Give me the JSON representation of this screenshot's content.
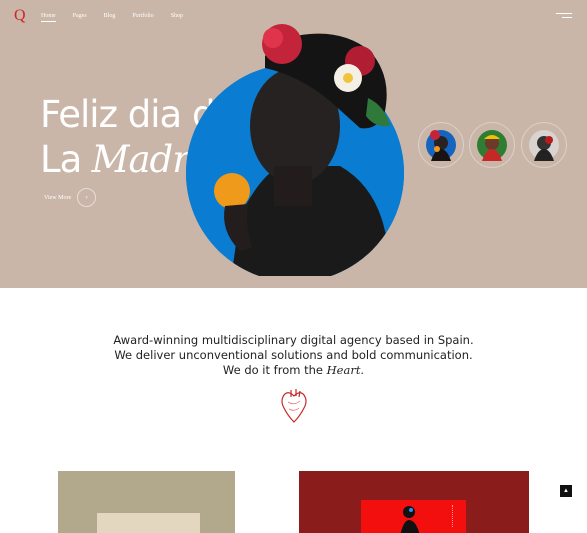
{
  "logo": {
    "text": "Q",
    "color": "#d2232a"
  },
  "nav": {
    "items": [
      "Home",
      "Pages",
      "Blog",
      "Portfolio",
      "Shop"
    ],
    "active": "Home"
  },
  "menu": {
    "icon": "hamburger-icon"
  },
  "hero": {
    "title_line1": "Feliz dia de",
    "title_line2_plain": "La",
    "title_line2_italic": "Madre",
    "view_more": "View More",
    "background_color": "#c9b6a8",
    "circle_color": "#0a7cd1"
  },
  "thumbnails": [
    "portrait-thumbnail-1",
    "portrait-thumbnail-2",
    "portrait-thumbnail-3"
  ],
  "intro": {
    "line1": "Award-winning multidisciplinary digital agency based in Spain.",
    "line2": "We deliver unconventional solutions and bold communication.",
    "line3_plain": "We do it from the",
    "line3_italic": "Heart."
  },
  "colors": {
    "accent_red": "#d2232a",
    "card_red": "#8a1d1c",
    "card_tan": "#b2a98c"
  },
  "scroll_top": {
    "icon": "arrow-up-icon"
  }
}
